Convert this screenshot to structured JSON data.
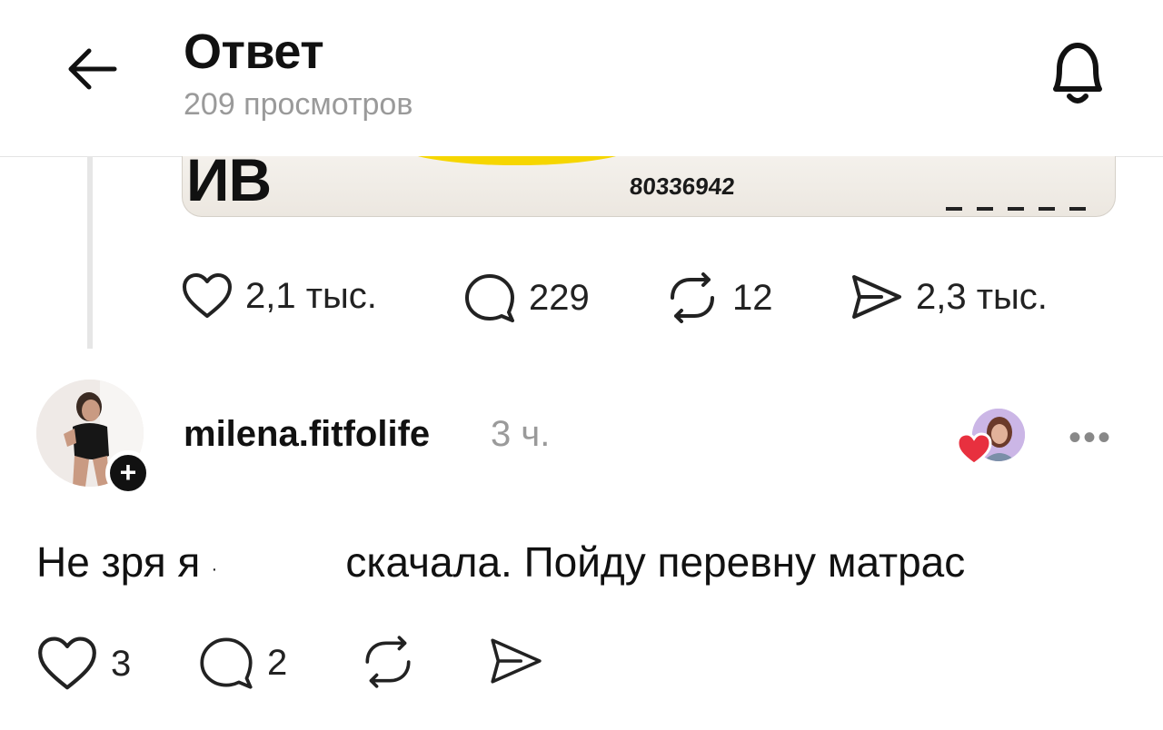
{
  "header": {
    "title": "Ответ",
    "subtitle": "209 просмотров"
  },
  "embedded_image": {
    "big_text": "ИВ",
    "number": "80336942"
  },
  "post_actions": {
    "likes": "2,1 тыс.",
    "comments": "229",
    "reposts": "12",
    "shares": "2,3 тыс."
  },
  "reply": {
    "username": "milena.fitfolife",
    "time": "3 ч.",
    "text_before": "Не зря я",
    "text_after": "скачала. Пойду перевну матрас",
    "more": "•••",
    "actions": {
      "likes": "3",
      "comments": "2"
    }
  },
  "colors": {
    "liked_heart": "#e8303f",
    "muted": "#9a9a9a",
    "thread_line": "#e6e6e6",
    "image_yellow": "#f6d600"
  },
  "icons": [
    "back-arrow-icon",
    "bell-icon",
    "heart-icon",
    "comment-icon",
    "repost-icon",
    "share-icon",
    "plus-icon",
    "more-icon"
  ]
}
